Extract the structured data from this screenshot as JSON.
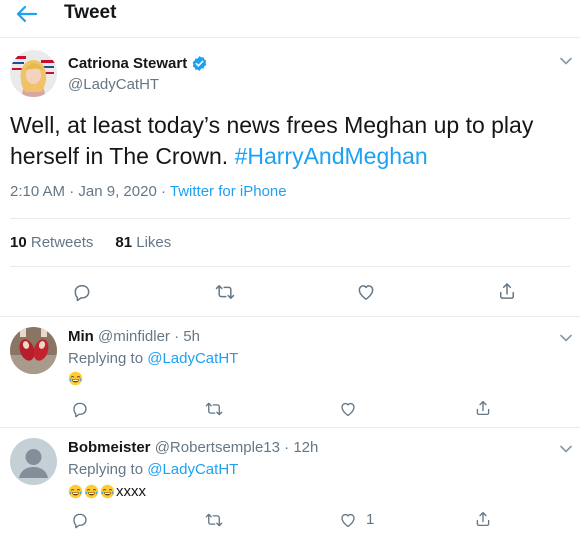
{
  "header": {
    "title": "Tweet"
  },
  "tweet": {
    "author_name": "Catriona Stewart",
    "author_handle": "@LadyCatHT",
    "text_main": "Well, at least today’s news frees Meghan up to play herself in The Crown.",
    "hashtag": "#HarryAndMeghan",
    "time": "2:10 AM",
    "separator": "·",
    "date": "Jan 9, 2020",
    "source": "Twitter for iPhone",
    "retweets_count": "10",
    "retweets_label": "Retweets",
    "likes_count": "81",
    "likes_label": "Likes"
  },
  "replies": [
    {
      "name": "Min",
      "handle": "@minfidler",
      "separator": "·",
      "time": "5h",
      "replying_prefix": "Replying to",
      "replying_to": "@LadyCatHT",
      "emoji_count": 1,
      "text": "",
      "like_count": ""
    },
    {
      "name": "Bobmeister",
      "handle": "@Robertsemple13",
      "separator": "·",
      "time": "12h",
      "replying_prefix": "Replying to",
      "replying_to": "@LadyCatHT",
      "emoji_count": 3,
      "text": "xxxx",
      "like_count": "1"
    }
  ],
  "icons": {
    "back": "arrow-left-icon",
    "verified": "verified-badge-icon",
    "more": "chevron-down-icon",
    "reply": "reply-icon",
    "retweet": "retweet-icon",
    "like": "heart-icon",
    "share": "share-icon",
    "emoji": "face-with-tears-of-joy-emoji"
  },
  "colors": {
    "accent": "#1da1f2",
    "text": "#14171a",
    "muted": "#657786",
    "divider": "#e6ecf0"
  }
}
